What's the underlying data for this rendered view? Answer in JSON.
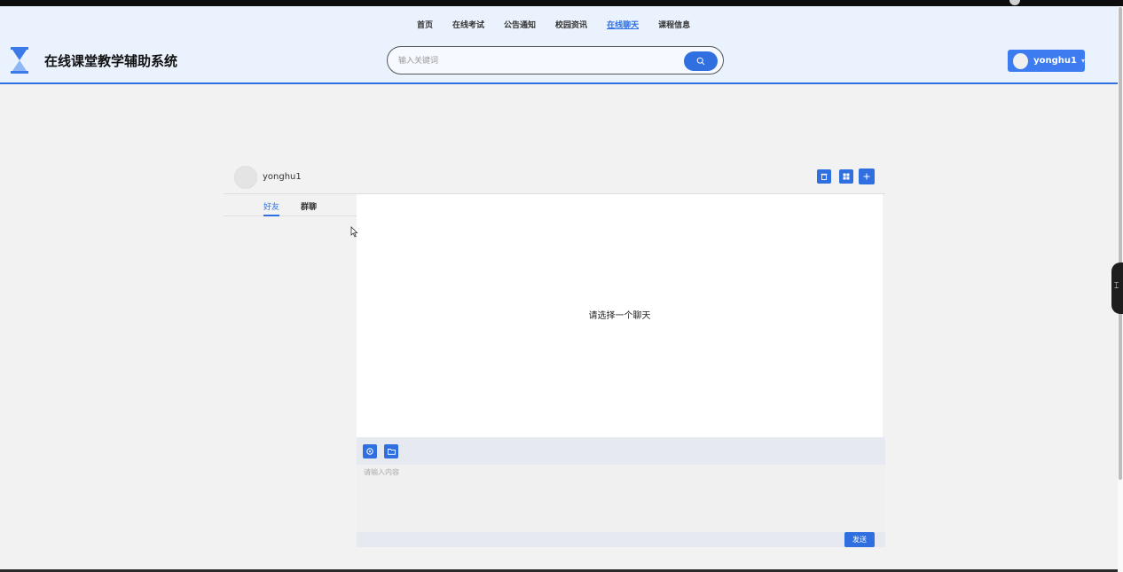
{
  "nav": {
    "items": [
      "首页",
      "在线考试",
      "公告通知",
      "校园资讯",
      "在线聊天",
      "课程信息"
    ],
    "active_index": 4
  },
  "brand": {
    "title": "在线课堂教学辅助系统",
    "logo_icon": "hourglass-icon"
  },
  "search": {
    "placeholder": "输入关键词",
    "button_icon": "search-icon"
  },
  "user_menu": {
    "username": "yonghu1",
    "caret": "▾"
  },
  "chat": {
    "current_user": "yonghu1",
    "tabs": [
      {
        "label": "好友",
        "active": true
      },
      {
        "label": "群聊",
        "active": false
      }
    ],
    "toolbar_icons": [
      "trash-icon",
      "grid-icon",
      "plus-icon"
    ],
    "empty_message": "请选择一个聊天",
    "input": {
      "placeholder": "请输入内容",
      "tool_icons": [
        "emoji-icon",
        "folder-icon"
      ],
      "send_label": "发送"
    }
  },
  "side_handle_label": "⌶",
  "colors": {
    "accent": "#2f6fe0",
    "header_bg": "#eaf2fd",
    "page_bg": "#f2f2f2"
  }
}
